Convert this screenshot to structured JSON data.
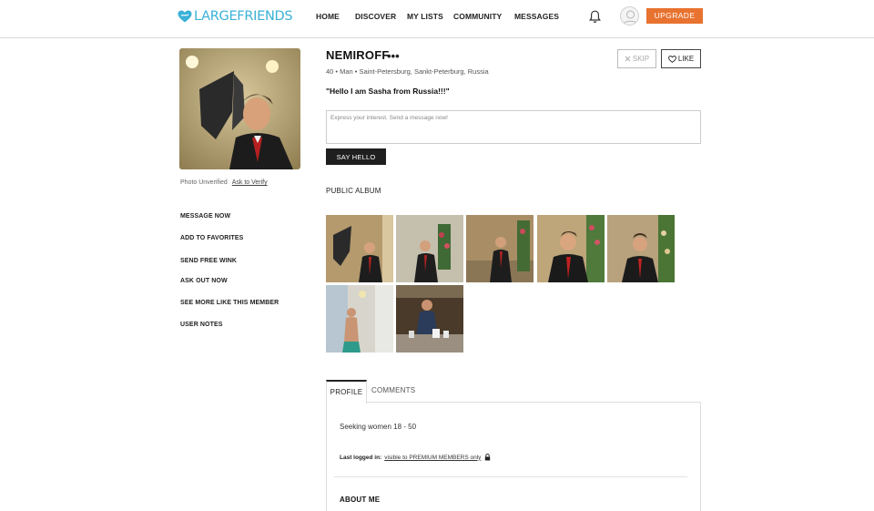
{
  "header": {
    "logo_text": "LARGEFRIENDS",
    "nav": [
      "HOME",
      "DISCOVER",
      "MY LISTS",
      "COMMUNITY",
      "MESSAGES"
    ],
    "upgrade_label": "UPGRADE",
    "brand_color": "#3ab1d6",
    "accent_color": "#e8722f"
  },
  "sidebar": {
    "photo_status": "Photo Unverified",
    "verify_link": "Ask to Verify",
    "actions": [
      "MESSAGE NOW",
      "ADD TO FAVORITES",
      "SEND FREE WINK",
      "ASK OUT NOW",
      "SEE MORE LIKE THIS MEMBER",
      "USER NOTES"
    ]
  },
  "profile": {
    "name": "NEMIROFF",
    "menu_icon": "•••",
    "meta": "40 • Man • Saint-Petersburg, Sankt-Peterburg, Russia",
    "headline": "\"Hello I am Sasha from Russia!!!\"",
    "skip_label": "SKIP",
    "like_label": "LIKE",
    "message_placeholder": "Express your interest. Send a message now!",
    "say_hello_label": "SAY HELLO",
    "album_title": "PUBLIC ALBUM"
  },
  "tabs": {
    "profile_label": "PROFILE",
    "comments_label": "COMMENTS"
  },
  "details": {
    "seeking": "Seeking women 18 - 50",
    "last_logged_label": "Last logged in:",
    "last_logged_value": "visible to PREMIUM MEMBERS only",
    "about_me_label": "ABOUT ME"
  }
}
